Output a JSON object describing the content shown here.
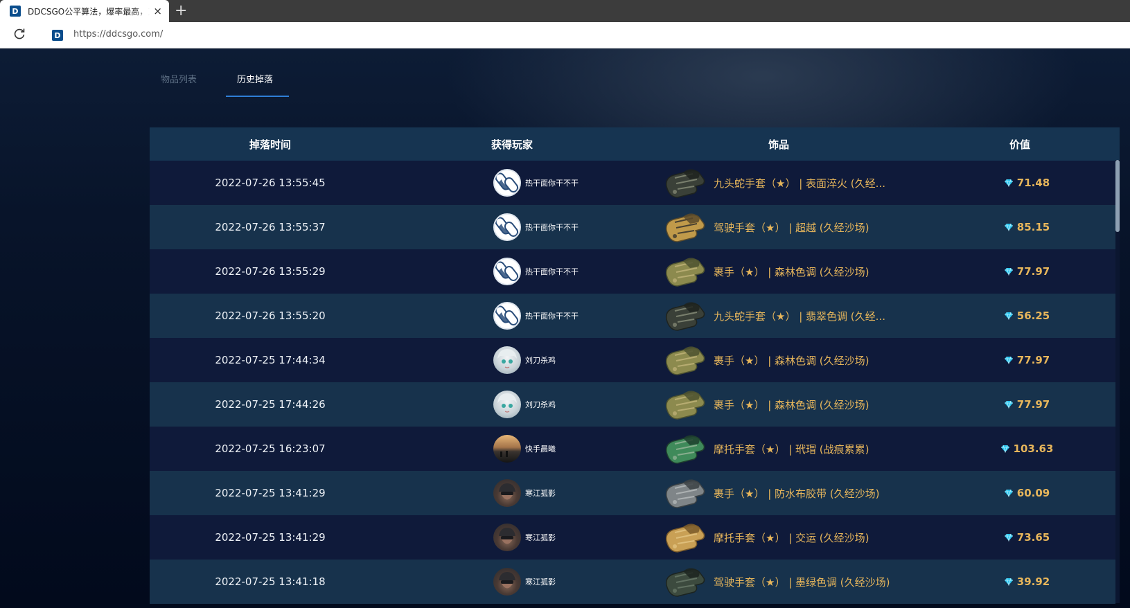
{
  "browser": {
    "tab_title": "DDCSGO公平算法，爆率最高，刀",
    "favicon_letter": "D",
    "new_tab_label": "+",
    "close_label": "×",
    "url": "https://ddcsgo.com/"
  },
  "tabs": [
    {
      "label": "物品列表",
      "active": false
    },
    {
      "label": "历史掉落",
      "active": true
    }
  ],
  "table": {
    "headers": [
      "掉落时间",
      "获得玩家",
      "饰品",
      "价值"
    ],
    "rows": [
      {
        "time": "2022-07-26 13:55:45",
        "player": "热干面你干不干",
        "avatar": "pill-icon",
        "item": "九头蛇手套（★） | 表面淬火 (久经...",
        "glove": "hydra",
        "value": "71.48"
      },
      {
        "time": "2022-07-26 13:55:37",
        "player": "热干面你干不干",
        "avatar": "pill-icon",
        "item": "驾驶手套（★） | 超越 (久经沙场)",
        "glove": "driver-gold",
        "value": "85.15"
      },
      {
        "time": "2022-07-26 13:55:29",
        "player": "热干面你干不干",
        "avatar": "pill-icon",
        "item": "裹手（★） | 森林色调 (久经沙场)",
        "glove": "wrap-forest",
        "value": "77.97"
      },
      {
        "time": "2022-07-26 13:55:20",
        "player": "热干面你干不干",
        "avatar": "pill-icon",
        "item": "九头蛇手套（★） | 翡翠色调 (久经...",
        "glove": "hydra",
        "value": "56.25"
      },
      {
        "time": "2022-07-25 17:44:34",
        "player": "刘刀杀鸡",
        "avatar": "anime-avatar",
        "item": "裹手（★） | 森林色调 (久经沙场)",
        "glove": "wrap-forest",
        "value": "77.97"
      },
      {
        "time": "2022-07-25 17:44:26",
        "player": "刘刀杀鸡",
        "avatar": "anime-avatar",
        "item": "裹手（★） | 森林色调 (久经沙场)",
        "glove": "wrap-forest",
        "value": "77.97"
      },
      {
        "time": "2022-07-25 16:23:07",
        "player": "快手晨曦",
        "avatar": "sunset-avatar",
        "item": "摩托手套（★） | 玳瑁 (战痕累累)",
        "glove": "moto-green",
        "value": "103.63"
      },
      {
        "time": "2022-07-25 13:41:29",
        "player": "寒江孤影",
        "avatar": "helmet-avatar",
        "item": "裹手（★） | 防水布胶带 (久经沙场)",
        "glove": "wrap-grey",
        "value": "60.09"
      },
      {
        "time": "2022-07-25 13:41:29",
        "player": "寒江孤影",
        "avatar": "helmet-avatar",
        "item": "摩托手套（★） | 交运 (久经沙场)",
        "glove": "moto-tan",
        "value": "73.65"
      },
      {
        "time": "2022-07-25 13:41:18",
        "player": "寒江孤影",
        "avatar": "helmet-avatar",
        "item": "驾驶手套（★） | 墨绿色调 (久经沙场)",
        "glove": "driver-dark",
        "value": "39.92"
      }
    ]
  },
  "colors": {
    "accent": "#2f7fd7",
    "gold_text": "#e7b65b",
    "header_bg": "#163451",
    "row_odd": "#0f1a3a",
    "row_even": "#17324c",
    "gem": "#29c6f0"
  }
}
